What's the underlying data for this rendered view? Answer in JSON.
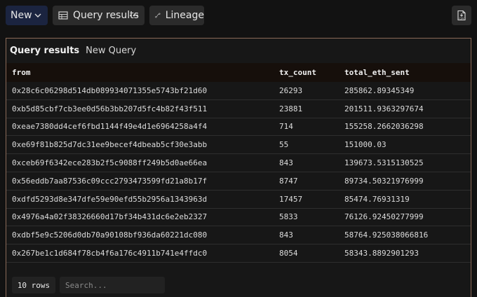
{
  "toolbar": {
    "new_label": "New",
    "query_results_label": "Query results",
    "lineage_label": "Lineage",
    "export_csv_icon": "csv-download-icon"
  },
  "panel": {
    "title": "Query results",
    "subtitle": "New Query"
  },
  "table": {
    "columns": [
      "from",
      "tx_count",
      "total_eth_sent"
    ],
    "rows": [
      [
        "0x28c6c06298d514db089934071355e5743bf21d60",
        "26293",
        "285862.89345349"
      ],
      [
        "0xb5d85cbf7cb3ee0d56b3bb207d5fc4b82f43f511",
        "23881",
        "201511.9363297674"
      ],
      [
        "0xeae7380dd4cef6fbd1144f49e4d1e6964258a4f4",
        "714",
        "155258.2662036298"
      ],
      [
        "0xe69f81b825d7dc31ee9becef4dbeab5cf30e3abb",
        "55",
        "151000.03"
      ],
      [
        "0xceb69f6342ece283b2f5c9088ff249b5d0ae66ea",
        "843",
        "139673.5315130525"
      ],
      [
        "0x56eddb7aa87536c09ccc2793473599fd21a8b17f",
        "8747",
        "89734.50321976999"
      ],
      [
        "0xdfd5293d8e347dfe59e90efd55b2956a1343963d",
        "17457",
        "85474.76931319"
      ],
      [
        "0x4976a4a02f38326660d17bf34b431dc6e2eb2327",
        "5833",
        "76126.92450277999"
      ],
      [
        "0xdbf5e9c5206d0db70a90108bf936da60221dc080",
        "843",
        "58764.925038066816"
      ],
      [
        "0x267be1c1d684f78cb4f6a176c4911b741e4ffdc0",
        "8054",
        "58343.8892901293"
      ]
    ]
  },
  "footer": {
    "rows_label": "10 rows",
    "search_placeholder": "Search..."
  },
  "colors": {
    "background": "#121212",
    "new_button": "#1b2440",
    "panel_border": "#8a6a58",
    "header_bg": "#160f0b"
  }
}
